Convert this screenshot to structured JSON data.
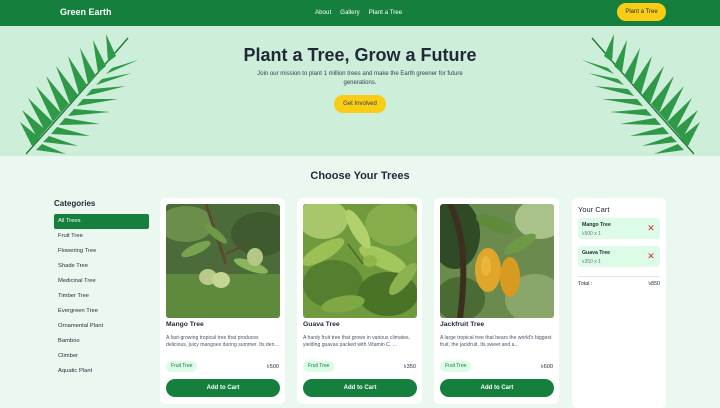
{
  "nav": {
    "brand": "Green Earth",
    "links": [
      "About",
      "Gallery",
      "Plant a Tree"
    ],
    "cta": "Plant a Tree"
  },
  "hero": {
    "title": "Plant a Tree, Grow a Future",
    "subtitle": "Join our mission to plant 1 million trees and make the Earth greener for future generations.",
    "button": "Get Involved"
  },
  "section_title": "Choose Your Trees",
  "categories": {
    "title": "Categories",
    "items": [
      "All Trees",
      "Fruit Tree",
      "Flowering Tree",
      "Shade Tree",
      "Medicinal Tree",
      "Timber Tree",
      "Evergreen Tree",
      "Ornamental Plant",
      "Bamboo",
      "Climber",
      "Aquatic Plant"
    ],
    "active": "All Trees"
  },
  "products": [
    {
      "name": "Mango Tree",
      "description": "A fast-growing tropical tree that produces delicious, juicy mangoes during summer. Its den...",
      "category": "Fruit Tree",
      "price": "৳500",
      "button": "Add to Cart"
    },
    {
      "name": "Guava Tree",
      "description": "A hardy fruit tree that grows in various climates, yielding guavas packed with Vitamin C. ...",
      "category": "Fruit Tree",
      "price": "৳350",
      "button": "Add to Cart"
    },
    {
      "name": "Jackfruit Tree",
      "description": "A large tropical tree that bears the world's biggest fruit, the jackfruit. Its sweet and a...",
      "category": "Fruit Tree",
      "price": "৳600",
      "button": "Add to Cart"
    }
  ],
  "cart": {
    "title": "Your Cart",
    "items": [
      {
        "name": "Mango Tree",
        "qty": "৳500 x 1"
      },
      {
        "name": "Guava Tree",
        "qty": "৳350 x 1"
      }
    ],
    "total_label": "Total :",
    "total_value": "৳850"
  },
  "colors": {
    "primary": "#15803d",
    "accent": "#facc15",
    "hero_bg": "#cdeed9",
    "page_bg": "#eaf8ef",
    "remove": "#dc2626"
  }
}
